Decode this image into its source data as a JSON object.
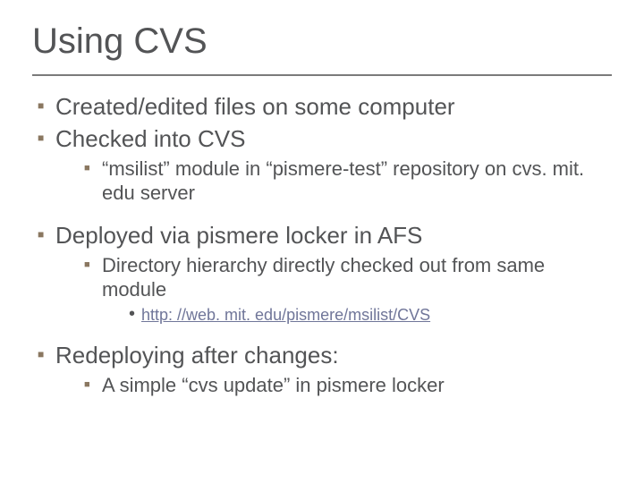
{
  "title": "Using CVS",
  "bullets": {
    "b1": "Created/edited files on some computer",
    "b2": "Checked into CVS",
    "b2a": "“msilist” module in “pismere-test” repository on cvs. mit. edu server",
    "b3": "Deployed via pismere locker in AFS",
    "b3a": "Directory hierarchy directly checked out from same module",
    "b3a1": "http: //web. mit. edu/pismere/msilist/CVS",
    "b4": "Redeploying after changes:",
    "b4a": "A simple “cvs update” in pismere locker"
  }
}
